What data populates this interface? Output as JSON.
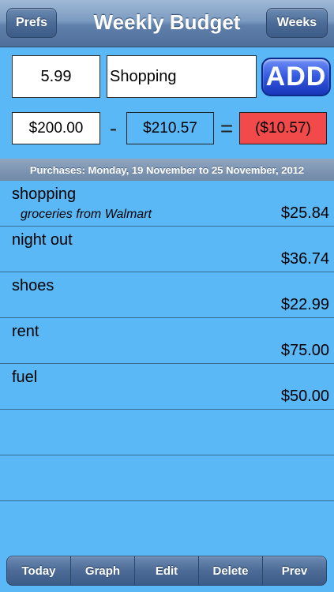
{
  "navbar": {
    "title": "Weekly Budget",
    "left_button": "Prefs",
    "right_button": "Weeks"
  },
  "entry": {
    "amount_value": "5.99",
    "description_value": "Shopping",
    "add_label": "ADD"
  },
  "calc": {
    "budget": "$200.00",
    "minus": "-",
    "spent": "$210.57",
    "equals": "=",
    "balance": "($10.57)",
    "balance_color": "#f24a4a"
  },
  "section": {
    "header": "Purchases: Monday, 19 November to 25 November, 2012"
  },
  "purchases": [
    {
      "name": "shopping",
      "note": "groceries from Walmart",
      "amount": "$25.84"
    },
    {
      "name": "night out",
      "note": "",
      "amount": "$36.74"
    },
    {
      "name": "shoes",
      "note": "",
      "amount": "$22.99"
    },
    {
      "name": "rent",
      "note": "",
      "amount": "$75.00"
    },
    {
      "name": "fuel",
      "note": "",
      "amount": "$50.00"
    }
  ],
  "toolbar": {
    "today": "Today",
    "graph": "Graph",
    "edit": "Edit",
    "delete": "Delete",
    "prev": "Prev"
  },
  "colors": {
    "background": "#5ab8f7",
    "add_button": "#3358e0"
  }
}
